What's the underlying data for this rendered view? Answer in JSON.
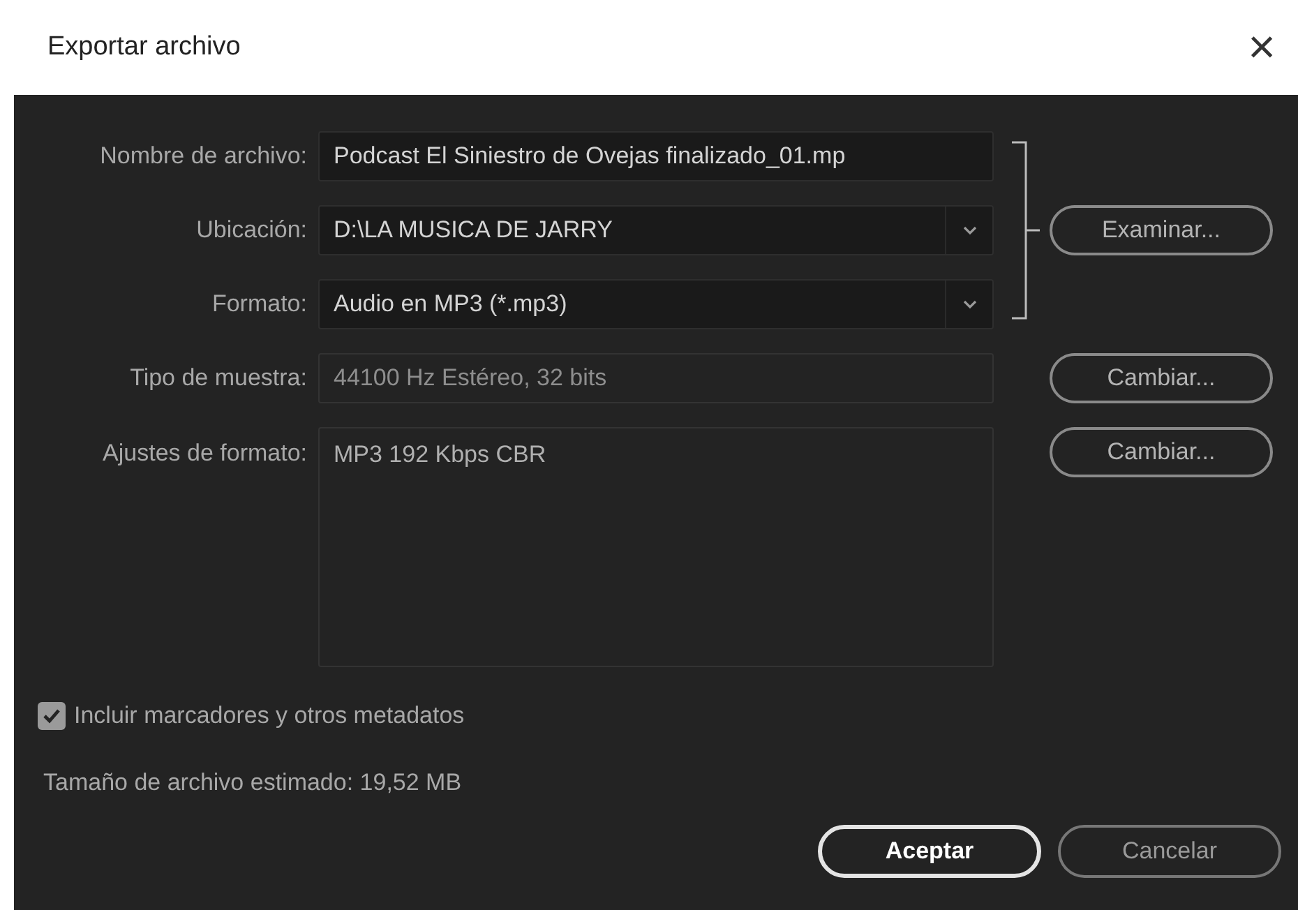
{
  "window": {
    "title": "Exportar archivo",
    "close": "×"
  },
  "fields": [
    {
      "label": "Nombre de archivo:",
      "kind": "text",
      "value": "Podcast El Siniestro de Ovejas finalizado_01.mp"
    },
    {
      "label": "Ubicación:",
      "kind": "dropdown",
      "value": "D:\\LA MUSICA DE JARRY",
      "button": "Examinar..."
    },
    {
      "label": "Formato:",
      "kind": "dropdown",
      "value": "Audio en MP3 (*.mp3)"
    },
    {
      "label": "Tipo de muestra:",
      "kind": "readonly",
      "value": "44100 Hz Estéreo, 32 bits",
      "button": "Cambiar..."
    },
    {
      "label": "Ajustes de formato:",
      "kind": "textarea",
      "value": "MP3 192 Kbps CBR",
      "button": "Cambiar..."
    }
  ],
  "checkbox": {
    "label": "Incluir marcadores y otros metadatos",
    "checked": true
  },
  "estimate": "Tamaño de archivo estimado: 19,52 MB",
  "buttons": [
    {
      "label": "Aceptar",
      "default": true
    },
    {
      "label": "Cancelar",
      "default": false
    }
  ]
}
